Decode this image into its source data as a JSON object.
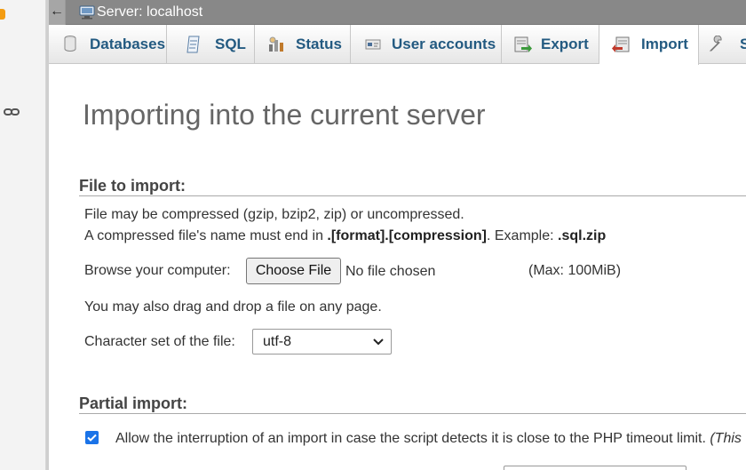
{
  "window": {
    "server_title": "Server: localhost"
  },
  "tabs": [
    {
      "label": "Databases",
      "icon": "databases-icon"
    },
    {
      "label": "SQL",
      "icon": "sql-icon"
    },
    {
      "label": "Status",
      "icon": "status-icon"
    },
    {
      "label": "User accounts",
      "icon": "user-accounts-icon"
    },
    {
      "label": "Export",
      "icon": "export-icon"
    },
    {
      "label": "Import",
      "icon": "import-icon",
      "active": true
    },
    {
      "label": "S",
      "icon": "settings-icon"
    }
  ],
  "page": {
    "title": "Importing into the current server"
  },
  "file_section": {
    "title": "File to import:",
    "compression_note": "File may be compressed (gzip, bzip2, zip) or uncompressed.",
    "name_note_prefix": "A compressed file's name must end in ",
    "name_note_format": ".[format].[compression]",
    "name_note_example_prefix": ". Example: ",
    "name_note_example": ".sql.zip",
    "browse_label": "Browse your computer:",
    "choose_button": "Choose File",
    "no_file": "No file chosen",
    "max_size": "(Max: 100MiB)",
    "drag_note": "You may also drag and drop a file on any page.",
    "charset_label": "Character set of the file:",
    "charset_value": "utf-8"
  },
  "partial_section": {
    "title": "Partial import:",
    "interrupt_label": "Allow the interruption of an import in case the script detects it is close to the PHP timeout limit. ",
    "interrupt_suffix": "(This",
    "interrupt_checked": true
  },
  "colors": {
    "tab_text": "#235a81",
    "topbar": "#888888",
    "checkbox": "#1a73e8"
  }
}
